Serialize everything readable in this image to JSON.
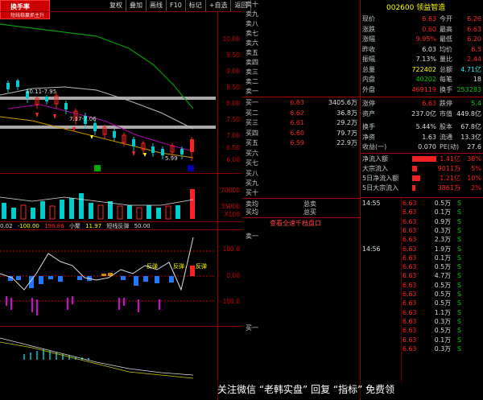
{
  "logo": {
    "name": "换手率",
    "sub": "短线稳赢抓主升"
  },
  "toolbar": [
    "复权",
    "叠加",
    "画线",
    "F10",
    "标记",
    "+自选",
    "返回"
  ],
  "header_right": "002600 领益智造",
  "price_axis": [
    "10.00",
    "9.50",
    "9.00",
    "8.50",
    "8.00",
    "7.50",
    "7.00",
    "6.50",
    "6.00"
  ],
  "price_marks": {
    "high": "10.11",
    "high2": "7.95",
    "mid1": "7.17",
    "mid2": "7.06",
    "low": "5.99"
  },
  "vol_axis": [
    "70000",
    "35000",
    "X100"
  ],
  "indicator_bar": [
    "0.02",
    "-100.00",
    "196.86",
    "小聚",
    "11.97",
    "短线反弹",
    "50.00"
  ],
  "macd_axis": [
    "100.0",
    "0.00",
    "-100.0"
  ],
  "labels": {
    "fan1": "反弹",
    "fan2": "反弹",
    "fan3": "反弹",
    "buy": "买",
    "sell": "卖"
  },
  "sell_labels": [
    "卖十",
    "卖九",
    "卖八",
    "卖七",
    "卖六",
    "卖五",
    "卖四",
    "卖三",
    "卖二",
    "卖一"
  ],
  "buy_orders": [
    {
      "label": "买一",
      "price": "6.63",
      "vol": "3405.6万"
    },
    {
      "label": "买二",
      "price": "6.62",
      "vol": "36.8万"
    },
    {
      "label": "买三",
      "price": "6.61",
      "vol": "29.2万"
    },
    {
      "label": "买四",
      "price": "6.60",
      "vol": "79.7万"
    },
    {
      "label": "买五",
      "price": "6.59",
      "vol": "22.9万"
    },
    {
      "label": "买六",
      "price": "",
      "vol": ""
    },
    {
      "label": "买七",
      "price": "",
      "vol": ""
    },
    {
      "label": "买八",
      "price": "",
      "vol": ""
    },
    {
      "label": "买九",
      "price": "",
      "vol": ""
    },
    {
      "label": "买十",
      "price": "",
      "vol": ""
    }
  ],
  "avg": {
    "sell_avg": "卖均",
    "buy_avg": "买均",
    "total_sell": "总卖",
    "total_buy": "总买"
  },
  "view_all": "查看全速千档盘口",
  "queue_sell": "卖一",
  "queue_buy": "买一",
  "quote": [
    {
      "k1": "现价",
      "v1": "6.63",
      "k2": "今开",
      "v2": "6.26",
      "c1": "red",
      "c2": "red"
    },
    {
      "k1": "涨跌",
      "v1": "0.60",
      "k2": "最高",
      "v2": "6.63",
      "c1": "red",
      "c2": "red"
    },
    {
      "k1": "涨幅",
      "v1": "9.95%",
      "k2": "最低",
      "v2": "6.20",
      "c1": "red",
      "c2": "red"
    },
    {
      "k1": "昨收",
      "v1": "6.03",
      "k2": "均价",
      "v2": "6.5",
      "c1": "wht",
      "c2": "red"
    },
    {
      "k1": "振幅",
      "v1": "7.13%",
      "k2": "量比",
      "v2": "2.44",
      "c1": "wht",
      "c2": "red"
    },
    {
      "k1": "总量",
      "v1": "722402",
      "k2": "总额",
      "v2": "4.71亿",
      "c1": "yel",
      "c2": "cyn"
    },
    {
      "k1": "内盘",
      "v1": "40202",
      "k2": "每笔",
      "v2": "18",
      "c1": "grn",
      "c2": "wht"
    },
    {
      "k1": "外盘",
      "v1": "469119",
      "k2": "换手",
      "v2": "253283",
      "c1": "red",
      "c2": "grn"
    },
    {
      "k1": "涨停",
      "v1": "6.63",
      "k2": "跌停",
      "v2": "5.4",
      "c1": "red",
      "c2": "grn"
    },
    {
      "k1": "资产",
      "v1": "237.0亿",
      "k2": "市值",
      "v2": "449.8亿",
      "c1": "wht",
      "c2": "wht"
    },
    {
      "k1": "流通",
      "v1": "",
      "k2": "",
      "v2": "",
      "c1": "wht",
      "c2": "wht"
    },
    {
      "k1": "换手",
      "v1": "5.44%",
      "k2": "股本",
      "v2": "67.8亿",
      "c1": "wht",
      "c2": "wht"
    },
    {
      "k1": "净资",
      "v1": "1.63",
      "k2": "流通",
      "v2": "13.3亿",
      "c1": "wht",
      "c2": "wht"
    },
    {
      "k1": "收益(一)",
      "v1": "0.070",
      "k2": "PE(动)",
      "v2": "27.6",
      "c1": "wht",
      "c2": "wht"
    }
  ],
  "flows": [
    {
      "label": "净流入额",
      "value": "1.41亿",
      "pct": "38%"
    },
    {
      "label": "大宗流入",
      "value": "9011万",
      "pct": "5%"
    },
    {
      "label": "5日净流入额",
      "value": "1.21亿",
      "pct": "10%"
    },
    {
      "label": "5日大宗流入",
      "value": "3861万",
      "pct": "2%"
    }
  ],
  "ticks": [
    {
      "time": "14:55",
      "price": "6.63",
      "vol": "0.5万",
      "side": "S"
    },
    {
      "time": "",
      "price": "6.63",
      "vol": "0.1万",
      "side": "S"
    },
    {
      "time": "",
      "price": "6.63",
      "vol": "0.9万",
      "side": "S"
    },
    {
      "time": "",
      "price": "6.63",
      "vol": "0.3万",
      "side": "S"
    },
    {
      "time": "",
      "price": "6.63",
      "vol": "2.3万",
      "side": "S"
    },
    {
      "time": "14:56",
      "price": "6.63",
      "vol": "1.9万",
      "side": "S"
    },
    {
      "time": "",
      "price": "6.63",
      "vol": "0.1万",
      "side": "S"
    },
    {
      "time": "",
      "price": "6.63",
      "vol": "0.5万",
      "side": "S"
    },
    {
      "time": "",
      "price": "6.63",
      "vol": "4.7万",
      "side": "S"
    },
    {
      "time": "",
      "price": "6.63",
      "vol": "0.5万",
      "side": "S"
    },
    {
      "time": "",
      "price": "6.63",
      "vol": "0.5万",
      "side": "S"
    },
    {
      "time": "",
      "price": "6.63",
      "vol": "0.5万",
      "side": "S"
    },
    {
      "time": "",
      "price": "6.63",
      "vol": "1.1万",
      "side": "S"
    },
    {
      "time": "",
      "price": "6.63",
      "vol": "0.3万",
      "side": "S"
    },
    {
      "time": "",
      "price": "6.63",
      "vol": "0.5万",
      "side": "S"
    },
    {
      "time": "",
      "price": "6.63",
      "vol": "0.1万",
      "side": "S"
    },
    {
      "time": "",
      "price": "6.63",
      "vol": "0.3万",
      "side": "S"
    }
  ],
  "watermark": "关注微信 “老韩实盘” 回复 “指标” 免费领",
  "colors": {
    "up": "#ff2222",
    "down": "#00cccc",
    "bg": "#000000",
    "grid": "#880000"
  }
}
